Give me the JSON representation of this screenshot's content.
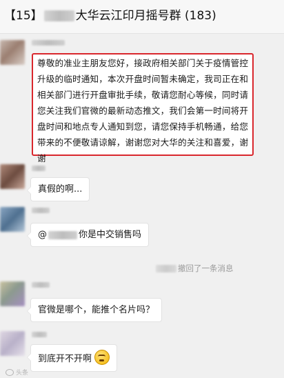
{
  "header": {
    "title_prefix": "【15】",
    "title_suffix": "大华云江印月摇号群 (183)"
  },
  "messages": [
    {
      "text": "尊敬的准业主朋友您好，接政府相关部门关于疫情管控升级的临时通知，本次开盘时间暂未确定，我司正在和相关部门进行开盘审批手续，敬请您耐心等候，同时请您关注我们官微的最新动态推文，我们会第一时间将开盘时间和地点专人通知到您，请您保持手机畅通，给您带来的不便敬请谅解，谢谢您对大华的关注和喜爱，谢谢"
    },
    {
      "text": "真假的啊..."
    },
    {
      "prefix": "@",
      "suffix": "你是中交销售吗"
    },
    {
      "text": "官微是哪个，能推个名片吗？"
    },
    {
      "text": "到底开不开啊"
    }
  ],
  "system_message": "撤回了一条消息",
  "watermark": "头条"
}
